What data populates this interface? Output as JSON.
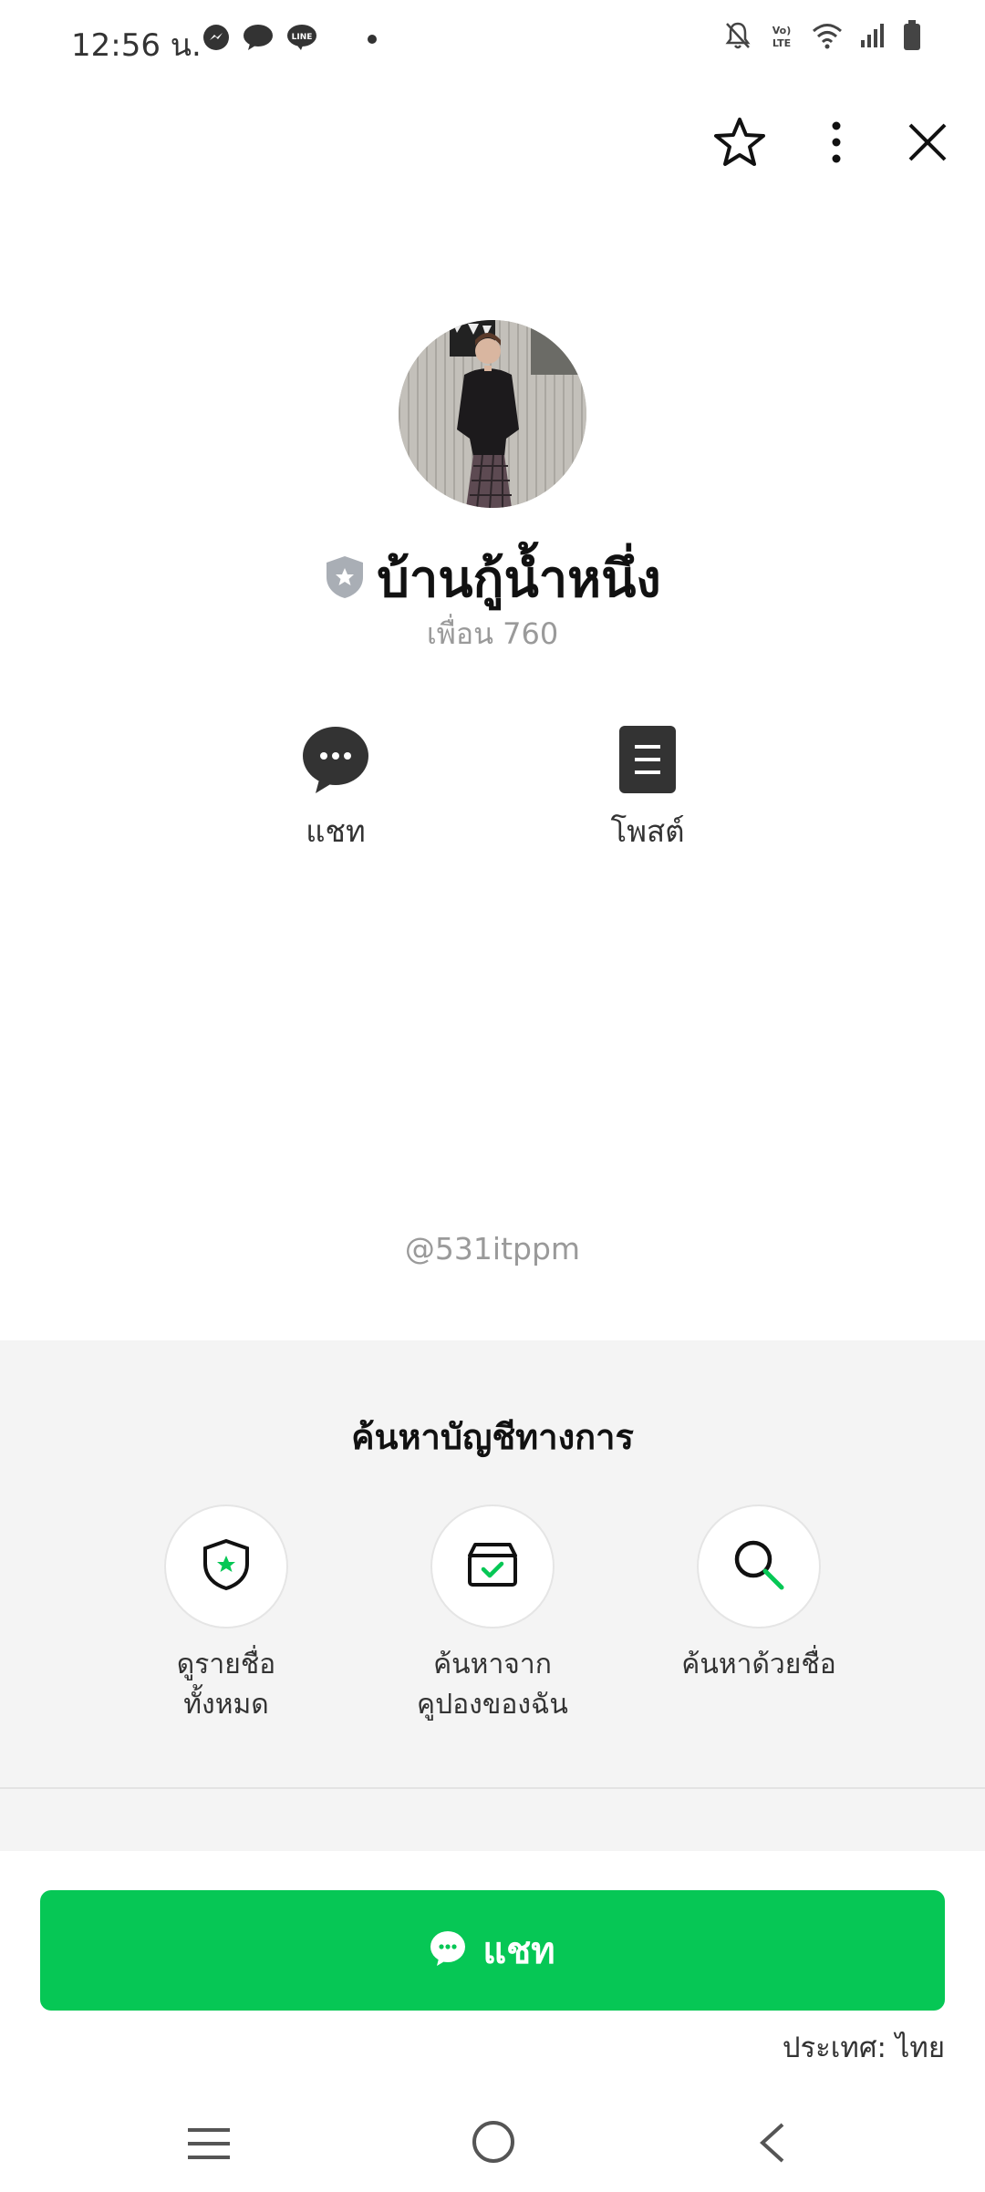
{
  "status_bar": {
    "time": "12:56 น.",
    "left_icons": [
      "messenger-icon",
      "chat-bubble-icon",
      "line-icon",
      "dot-icon"
    ],
    "right_icons": [
      "bell-off-icon",
      "volte-icon",
      "wifi-icon",
      "signal-icon",
      "battery-icon"
    ],
    "volte_label": "VoLTE"
  },
  "top_actions": [
    "star-icon",
    "more-vertical-icon",
    "close-icon"
  ],
  "profile": {
    "name": "บ้านกู้น้ำหนึ่ง",
    "friends": "เพื่อน 760",
    "handle": "@531itppm",
    "badge_icon": "verified-shield-icon"
  },
  "actions": [
    {
      "label": "แชท",
      "icon": "chat-icon"
    },
    {
      "label": "โพสต์",
      "icon": "post-icon"
    }
  ],
  "official_search": {
    "title": "ค้นหาบัญชีทางการ",
    "items": [
      {
        "line1": "ดูรายชื่อ",
        "line2": "ทั้งหมด",
        "icon": "shield-star-icon"
      },
      {
        "line1": "ค้นหาจาก",
        "line2": "คูปองของฉัน",
        "icon": "coupon-box-icon"
      },
      {
        "line1": "ค้นหาด้วยชื่อ",
        "line2": "",
        "icon": "search-icon"
      }
    ]
  },
  "cta": {
    "label": "แชท",
    "icon": "chat-icon",
    "color": "#06c755"
  },
  "country_label": "ประเทศ: ไทย",
  "navbar": [
    "recent-apps-icon",
    "home-icon",
    "back-icon"
  ]
}
